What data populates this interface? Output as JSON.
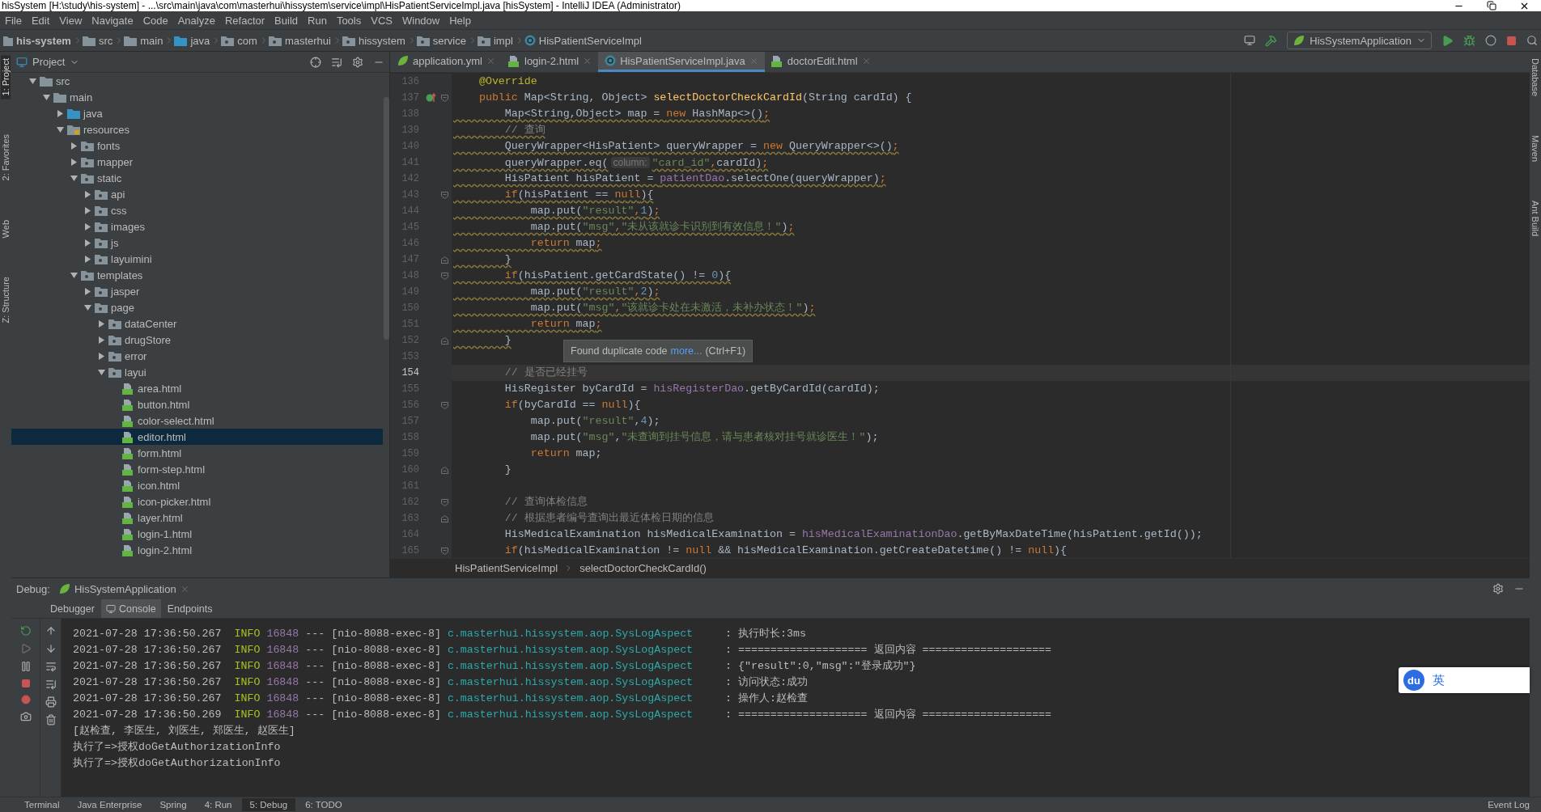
{
  "window": {
    "title": "hisSystem [H:\\study\\his-system] - ...\\src\\main\\java\\com\\masterhui\\hissystem\\service\\impl\\HisPatientServiceImpl.java [hisSystem] - IntelliJ IDEA (Administrator)"
  },
  "menu": [
    "File",
    "Edit",
    "View",
    "Navigate",
    "Code",
    "Analyze",
    "Refactor",
    "Build",
    "Run",
    "Tools",
    "VCS",
    "Window",
    "Help"
  ],
  "nav": {
    "crumbs": [
      {
        "label": "his-system",
        "kind": "module"
      },
      {
        "label": "src",
        "kind": "folder"
      },
      {
        "label": "main",
        "kind": "folder"
      },
      {
        "label": "java",
        "kind": "source"
      },
      {
        "label": "com",
        "kind": "package"
      },
      {
        "label": "masterhui",
        "kind": "package"
      },
      {
        "label": "hissystem",
        "kind": "package"
      },
      {
        "label": "service",
        "kind": "package"
      },
      {
        "label": "impl",
        "kind": "package"
      },
      {
        "label": "HisPatientServiceImpl",
        "kind": "class"
      }
    ],
    "run_config": "HisSystemApplication"
  },
  "left_strip": [
    {
      "label": "1: Project",
      "selected": true
    },
    {
      "label": "2: Favorites",
      "selected": false
    },
    {
      "label": "Web",
      "selected": false
    },
    {
      "label": "Z: Structure",
      "selected": false
    }
  ],
  "right_strip": [
    {
      "label": "Database",
      "selected": false
    },
    {
      "label": "Maven",
      "selected": false
    },
    {
      "label": "Ant Build",
      "selected": false
    }
  ],
  "project": {
    "title": "Project",
    "tree": [
      {
        "label": "src",
        "kind": "folder",
        "expanded": true,
        "selected": false,
        "children": [
          {
            "label": "main",
            "kind": "folder",
            "expanded": true,
            "selected": false,
            "children": [
              {
                "label": "java",
                "kind": "source",
                "expanded": false,
                "selected": false
              },
              {
                "label": "resources",
                "kind": "resources",
                "expanded": true,
                "selected": false,
                "children": [
                  {
                    "label": "fonts",
                    "kind": "package",
                    "expanded": false,
                    "selected": false
                  },
                  {
                    "label": "mapper",
                    "kind": "package",
                    "expanded": false,
                    "selected": false
                  },
                  {
                    "label": "static",
                    "kind": "package",
                    "expanded": true,
                    "selected": false,
                    "children": [
                      {
                        "label": "api",
                        "kind": "package",
                        "expanded": false,
                        "selected": false
                      },
                      {
                        "label": "css",
                        "kind": "package",
                        "expanded": false,
                        "selected": false
                      },
                      {
                        "label": "images",
                        "kind": "package",
                        "expanded": false,
                        "selected": false
                      },
                      {
                        "label": "js",
                        "kind": "package",
                        "expanded": false,
                        "selected": false
                      },
                      {
                        "label": "layuimini",
                        "kind": "package",
                        "expanded": false,
                        "selected": false
                      }
                    ]
                  },
                  {
                    "label": "templates",
                    "kind": "package",
                    "expanded": true,
                    "selected": false,
                    "children": [
                      {
                        "label": "jasper",
                        "kind": "package",
                        "expanded": false,
                        "selected": false
                      },
                      {
                        "label": "page",
                        "kind": "package",
                        "expanded": true,
                        "selected": false,
                        "children": [
                          {
                            "label": "dataCenter",
                            "kind": "package",
                            "expanded": false,
                            "selected": false
                          },
                          {
                            "label": "drugStore",
                            "kind": "package",
                            "expanded": false,
                            "selected": false
                          },
                          {
                            "label": "error",
                            "kind": "package",
                            "expanded": false,
                            "selected": false
                          },
                          {
                            "label": "layui",
                            "kind": "package",
                            "expanded": true,
                            "selected": false,
                            "children": [
                              {
                                "label": "area.html",
                                "kind": "html",
                                "selected": false
                              },
                              {
                                "label": "button.html",
                                "kind": "html",
                                "selected": false
                              },
                              {
                                "label": "color-select.html",
                                "kind": "html",
                                "selected": false
                              },
                              {
                                "label": "editor.html",
                                "kind": "html",
                                "selected": true
                              },
                              {
                                "label": "form.html",
                                "kind": "html",
                                "selected": false
                              },
                              {
                                "label": "form-step.html",
                                "kind": "html",
                                "selected": false
                              },
                              {
                                "label": "icon.html",
                                "kind": "html",
                                "selected": false
                              },
                              {
                                "label": "icon-picker.html",
                                "kind": "html",
                                "selected": false
                              },
                              {
                                "label": "layer.html",
                                "kind": "html",
                                "selected": false
                              },
                              {
                                "label": "login-1.html",
                                "kind": "html",
                                "selected": false
                              },
                              {
                                "label": "login-2.html",
                                "kind": "html",
                                "selected": false
                              }
                            ]
                          }
                        ]
                      }
                    ]
                  }
                ]
              }
            ]
          }
        ]
      }
    ]
  },
  "editor": {
    "tabs": [
      {
        "label": "application.yml",
        "kind": "yml",
        "selected": false
      },
      {
        "label": "login-2.html",
        "kind": "html",
        "selected": false
      },
      {
        "label": "HisPatientServiceImpl.java",
        "kind": "class",
        "selected": true
      },
      {
        "label": "doctorEdit.html",
        "kind": "html",
        "selected": false
      }
    ],
    "lines": [
      {
        "number": "136",
        "current": false,
        "duplicate": false,
        "override": false,
        "fold_start": false,
        "fold_end": false,
        "tokens": [
          {
            "kind": "annotation",
            "text": "    @Override"
          }
        ]
      },
      {
        "number": "137",
        "current": false,
        "duplicate": false,
        "override": true,
        "fold_start": true,
        "fold_end": false,
        "tokens": [
          {
            "kind": "keyword",
            "text": "    public "
          },
          {
            "kind": "plain",
            "text": "Map<String, Object> "
          },
          {
            "kind": "method",
            "text": "selectDoctorCheckCardId"
          },
          {
            "kind": "plain",
            "text": "(String cardId) {"
          }
        ]
      },
      {
        "number": "138",
        "current": false,
        "duplicate": true,
        "override": false,
        "fold_start": false,
        "fold_end": false,
        "tokens": [
          {
            "kind": "plain",
            "text": "        Map<String,Object> map = "
          },
          {
            "kind": "keyword",
            "text": "new "
          },
          {
            "kind": "plain",
            "text": "HashMap<>()"
          },
          {
            "kind": "keyword",
            "text": ";"
          }
        ]
      },
      {
        "number": "139",
        "current": false,
        "duplicate": true,
        "override": false,
        "fold_start": false,
        "fold_end": false,
        "tokens": [
          {
            "kind": "comment",
            "text": "        // 查询"
          }
        ]
      },
      {
        "number": "140",
        "current": false,
        "duplicate": true,
        "override": false,
        "fold_start": false,
        "fold_end": false,
        "tokens": [
          {
            "kind": "plain",
            "text": "        QueryWrapper<HisPatient> queryWrapper = "
          },
          {
            "kind": "keyword",
            "text": "new "
          },
          {
            "kind": "plain",
            "text": "QueryWrapper<>()"
          },
          {
            "kind": "keyword",
            "text": ";"
          }
        ]
      },
      {
        "number": "141",
        "current": false,
        "duplicate": true,
        "override": false,
        "fold_start": false,
        "fold_end": false,
        "tokens": [
          {
            "kind": "plain",
            "text": "        queryWrapper.eq("
          },
          {
            "kind": "hint",
            "text": "column:"
          },
          {
            "kind": "string",
            "text": "\"card_id\""
          },
          {
            "kind": "keyword",
            "text": ","
          },
          {
            "kind": "plain",
            "text": "cardId)"
          },
          {
            "kind": "keyword",
            "text": ";"
          }
        ]
      },
      {
        "number": "142",
        "current": false,
        "duplicate": true,
        "override": false,
        "fold_start": false,
        "fold_end": false,
        "tokens": [
          {
            "kind": "plain",
            "text": "        HisPatient hisPatient = "
          },
          {
            "kind": "field",
            "text": "patientDao"
          },
          {
            "kind": "plain",
            "text": ".selectOne(queryWrapper)"
          },
          {
            "kind": "keyword",
            "text": ";"
          }
        ]
      },
      {
        "number": "143",
        "current": false,
        "duplicate": true,
        "override": false,
        "fold_start": true,
        "fold_end": false,
        "tokens": [
          {
            "kind": "keyword",
            "text": "        if"
          },
          {
            "kind": "plain",
            "text": "(hisPatient == "
          },
          {
            "kind": "keyword",
            "text": "null"
          },
          {
            "kind": "plain",
            "text": "){"
          }
        ]
      },
      {
        "number": "144",
        "current": false,
        "duplicate": true,
        "override": false,
        "fold_start": false,
        "fold_end": false,
        "tokens": [
          {
            "kind": "plain",
            "text": "            map.put("
          },
          {
            "kind": "string",
            "text": "\"result\""
          },
          {
            "kind": "keyword",
            "text": ","
          },
          {
            "kind": "number",
            "text": "1"
          },
          {
            "kind": "plain",
            "text": ")"
          },
          {
            "kind": "keyword",
            "text": ";"
          }
        ]
      },
      {
        "number": "145",
        "current": false,
        "duplicate": true,
        "override": false,
        "fold_start": false,
        "fold_end": false,
        "tokens": [
          {
            "kind": "plain",
            "text": "            map.put("
          },
          {
            "kind": "string",
            "text": "\"msg\""
          },
          {
            "kind": "keyword",
            "text": ","
          },
          {
            "kind": "string",
            "text": "\"未从该就诊卡识别到有效信息！\""
          },
          {
            "kind": "plain",
            "text": ")"
          },
          {
            "kind": "keyword",
            "text": ";"
          }
        ]
      },
      {
        "number": "146",
        "current": false,
        "duplicate": true,
        "override": false,
        "fold_start": false,
        "fold_end": false,
        "tokens": [
          {
            "kind": "keyword",
            "text": "            return "
          },
          {
            "kind": "plain",
            "text": "map"
          },
          {
            "kind": "keyword",
            "text": ";"
          }
        ]
      },
      {
        "number": "147",
        "current": false,
        "duplicate": true,
        "override": false,
        "fold_start": false,
        "fold_end": true,
        "tokens": [
          {
            "kind": "plain",
            "text": "        }"
          }
        ]
      },
      {
        "number": "148",
        "current": false,
        "duplicate": true,
        "override": false,
        "fold_start": true,
        "fold_end": false,
        "tokens": [
          {
            "kind": "keyword",
            "text": "        if"
          },
          {
            "kind": "plain",
            "text": "(hisPatient.getCardState() != "
          },
          {
            "kind": "number",
            "text": "0"
          },
          {
            "kind": "plain",
            "text": "){"
          }
        ]
      },
      {
        "number": "149",
        "current": false,
        "duplicate": true,
        "override": false,
        "fold_start": false,
        "fold_end": false,
        "tokens": [
          {
            "kind": "plain",
            "text": "            map.put("
          },
          {
            "kind": "string",
            "text": "\"result\""
          },
          {
            "kind": "keyword",
            "text": ","
          },
          {
            "kind": "number",
            "text": "2"
          },
          {
            "kind": "plain",
            "text": ")"
          },
          {
            "kind": "keyword",
            "text": ";"
          }
        ]
      },
      {
        "number": "150",
        "current": false,
        "duplicate": true,
        "override": false,
        "fold_start": false,
        "fold_end": false,
        "tokens": [
          {
            "kind": "plain",
            "text": "            map.put("
          },
          {
            "kind": "string",
            "text": "\"msg\""
          },
          {
            "kind": "keyword",
            "text": ","
          },
          {
            "kind": "string",
            "text": "\"该就诊卡处在未激活，未补办状态！\""
          },
          {
            "kind": "plain",
            "text": ")"
          },
          {
            "kind": "keyword",
            "text": ";"
          }
        ]
      },
      {
        "number": "151",
        "current": false,
        "duplicate": true,
        "override": false,
        "fold_start": false,
        "fold_end": false,
        "tokens": [
          {
            "kind": "keyword",
            "text": "            return "
          },
          {
            "kind": "plain",
            "text": "map"
          },
          {
            "kind": "keyword",
            "text": ";"
          }
        ]
      },
      {
        "number": "152",
        "current": false,
        "duplicate": true,
        "override": false,
        "fold_start": false,
        "fold_end": true,
        "tokens": [
          {
            "kind": "plain",
            "text": "        }"
          }
        ]
      },
      {
        "number": "153",
        "current": false,
        "override": false,
        "fold_start": false,
        "fold_end": false
      },
      {
        "number": "154",
        "current": true,
        "duplicate": false,
        "override": false,
        "fold_start": false,
        "fold_end": false,
        "tokens": [
          {
            "kind": "comment",
            "text": "        // 是否已经挂号"
          }
        ]
      },
      {
        "number": "155",
        "current": false,
        "duplicate": false,
        "override": false,
        "fold_start": false,
        "fold_end": false,
        "tokens": [
          {
            "kind": "plain",
            "text": "        HisRegister byCardId = "
          },
          {
            "kind": "field",
            "text": "hisRegisterDao"
          },
          {
            "kind": "plain",
            "text": ".getByCardId(cardId);"
          }
        ]
      },
      {
        "number": "156",
        "current": false,
        "duplicate": false,
        "override": false,
        "fold_start": true,
        "fold_end": false,
        "tokens": [
          {
            "kind": "keyword",
            "text": "        if"
          },
          {
            "kind": "plain",
            "text": "(byCardId == "
          },
          {
            "kind": "keyword",
            "text": "null"
          },
          {
            "kind": "plain",
            "text": "){"
          }
        ]
      },
      {
        "number": "157",
        "current": false,
        "duplicate": false,
        "override": false,
        "fold_start": false,
        "fold_end": false,
        "tokens": [
          {
            "kind": "plain",
            "text": "            map.put("
          },
          {
            "kind": "string",
            "text": "\"result\""
          },
          {
            "kind": "plain",
            "text": ","
          },
          {
            "kind": "number",
            "text": "4"
          },
          {
            "kind": "plain",
            "text": ");"
          }
        ]
      },
      {
        "number": "158",
        "current": false,
        "duplicate": false,
        "override": false,
        "fold_start": false,
        "fold_end": false,
        "tokens": [
          {
            "kind": "plain",
            "text": "            map.put("
          },
          {
            "kind": "string",
            "text": "\"msg\""
          },
          {
            "kind": "plain",
            "text": ","
          },
          {
            "kind": "string",
            "text": "\"未查询到挂号信息，请与患者核对挂号就诊医生！\""
          },
          {
            "kind": "plain",
            "text": ");"
          }
        ]
      },
      {
        "number": "159",
        "current": false,
        "duplicate": false,
        "override": false,
        "fold_start": false,
        "fold_end": false,
        "tokens": [
          {
            "kind": "keyword",
            "text": "            return "
          },
          {
            "kind": "plain",
            "text": "map;"
          }
        ]
      },
      {
        "number": "160",
        "current": false,
        "duplicate": false,
        "override": false,
        "fold_start": false,
        "fold_end": true,
        "tokens": [
          {
            "kind": "plain",
            "text": "        }"
          }
        ]
      },
      {
        "number": "161",
        "current": false,
        "override": false,
        "fold_start": false,
        "fold_end": false
      },
      {
        "number": "162",
        "current": false,
        "duplicate": false,
        "override": false,
        "fold_start": true,
        "fold_end": false,
        "tokens": [
          {
            "kind": "comment",
            "text": "        // 查询体检信息"
          }
        ]
      },
      {
        "number": "163",
        "current": false,
        "duplicate": false,
        "override": false,
        "fold_start": false,
        "fold_end": true,
        "tokens": [
          {
            "kind": "comment",
            "text": "        // 根据患者编号查询出最近体检日期的信息"
          }
        ]
      },
      {
        "number": "164",
        "current": false,
        "duplicate": false,
        "override": false,
        "fold_start": false,
        "fold_end": false,
        "tokens": [
          {
            "kind": "plain",
            "text": "        HisMedicalExamination hisMedicalExamination = "
          },
          {
            "kind": "field",
            "text": "hisMedicalExaminationDao"
          },
          {
            "kind": "plain",
            "text": ".getByMaxDateTime(hisPatient.getId());"
          }
        ]
      },
      {
        "number": "165",
        "current": false,
        "duplicate": false,
        "override": false,
        "fold_start": true,
        "fold_end": false,
        "tokens": [
          {
            "kind": "keyword",
            "text": "        if"
          },
          {
            "kind": "plain",
            "text": "(hisMedicalExamination != "
          },
          {
            "kind": "keyword",
            "text": "null"
          },
          {
            "kind": "plain",
            "text": " && hisMedicalExamination.getCreateDatetime() != "
          },
          {
            "kind": "keyword",
            "text": "null"
          },
          {
            "kind": "plain",
            "text": "){"
          }
        ]
      }
    ],
    "tooltip": {
      "text": "Found duplicate code",
      "link": "more...",
      "shortcut": "(Ctrl+F1)"
    },
    "breadcrumb": [
      "HisPatientServiceImpl",
      "selectDoctorCheckCardId()"
    ]
  },
  "debug": {
    "label": "Debug:",
    "session": "HisSystemApplication",
    "tabs": [
      {
        "label": "Debugger",
        "kind": "debugger",
        "selected": false
      },
      {
        "label": "Console",
        "kind": "console",
        "selected": true
      },
      {
        "label": "Endpoints",
        "kind": "endpoints",
        "selected": false
      }
    ],
    "console": [
      {
        "kind": "log",
        "time": "2021-07-28 17:36:50.267",
        "level": "INFO",
        "pid": "16848",
        "sep": "---",
        "thread": "[nio-8088-exec-8]",
        "logger": "c.masterhui.hissystem.aop.SysLogAspect",
        "message": ": 执行时长:3ms"
      },
      {
        "kind": "log",
        "time": "2021-07-28 17:36:50.267",
        "level": "INFO",
        "pid": "16848",
        "sep": "---",
        "thread": "[nio-8088-exec-8]",
        "logger": "c.masterhui.hissystem.aop.SysLogAspect",
        "message": ": ==================== 返回内容 ===================="
      },
      {
        "kind": "log",
        "time": "2021-07-28 17:36:50.267",
        "level": "INFO",
        "pid": "16848",
        "sep": "---",
        "thread": "[nio-8088-exec-8]",
        "logger": "c.masterhui.hissystem.aop.SysLogAspect",
        "message": ": {\"result\":0,\"msg\":\"登录成功\"}"
      },
      {
        "kind": "log",
        "time": "2021-07-28 17:36:50.267",
        "level": "INFO",
        "pid": "16848",
        "sep": "---",
        "thread": "[nio-8088-exec-8]",
        "logger": "c.masterhui.hissystem.aop.SysLogAspect",
        "message": ": 访问状态:成功"
      },
      {
        "kind": "log",
        "time": "2021-07-28 17:36:50.267",
        "level": "INFO",
        "pid": "16848",
        "sep": "---",
        "thread": "[nio-8088-exec-8]",
        "logger": "c.masterhui.hissystem.aop.SysLogAspect",
        "message": ": 操作人:赵检查"
      },
      {
        "kind": "log",
        "time": "2021-07-28 17:36:50.269",
        "level": "INFO",
        "pid": "16848",
        "sep": "---",
        "thread": "[nio-8088-exec-8]",
        "logger": "c.masterhui.hissystem.aop.SysLogAspect",
        "message": ": ==================== 返回内容 ===================="
      },
      {
        "kind": "plain",
        "text": "[赵检查, 李医生, 刘医生, 郑医生, 赵医生]"
      },
      {
        "kind": "plain",
        "text": "执行了=>授权doGetAuthorizationInfo"
      },
      {
        "kind": "plain",
        "text": "执行了=>授权doGetAuthorizationInfo"
      }
    ]
  },
  "ime": {
    "logo": "du",
    "language": "英"
  },
  "tool_tabs": [
    {
      "label": "Terminal",
      "selected": false
    },
    {
      "label": "Java Enterprise",
      "selected": false
    },
    {
      "label": "Spring",
      "selected": false
    },
    {
      "label": "4: Run",
      "selected": false
    },
    {
      "label": "5: Debug",
      "selected": true
    },
    {
      "label": "6: TODO",
      "selected": false
    }
  ],
  "event_log": "Event Log"
}
